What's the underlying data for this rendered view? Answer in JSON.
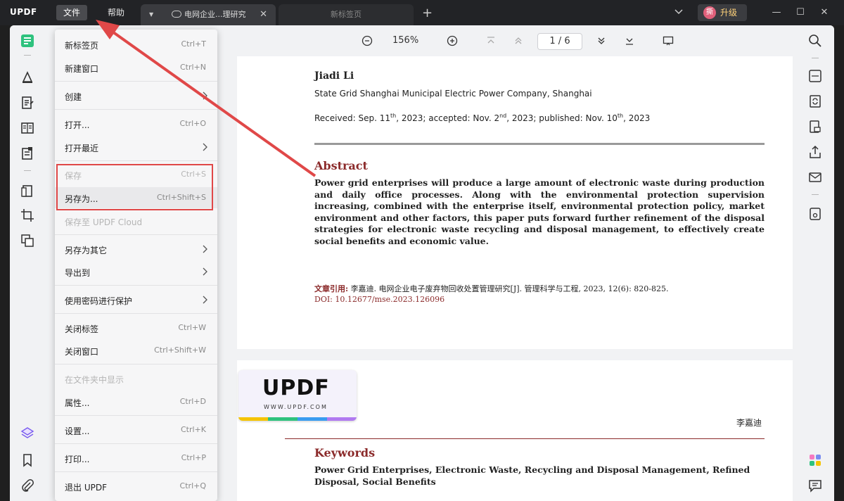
{
  "app": {
    "logo": "UPDF",
    "menus": [
      "文件",
      "帮助"
    ],
    "tabs": [
      {
        "label": "电网企业...理研究",
        "active": true
      },
      {
        "label": "新标签页",
        "active": false
      }
    ],
    "upgrade": {
      "avatar": "撕",
      "label": "升级"
    }
  },
  "toolbar": {
    "zoom": "156%",
    "page_current": "1",
    "page_sep": "/",
    "page_total": "6"
  },
  "file_menu": {
    "items": [
      {
        "label": "新标签页",
        "shortcut": "Ctrl+T"
      },
      {
        "label": "新建窗口",
        "shortcut": "Ctrl+N"
      },
      {
        "label": "创建",
        "submenu": true
      },
      {
        "label": "打开...",
        "shortcut": "Ctrl+O"
      },
      {
        "label": "打开最近",
        "submenu": true
      },
      {
        "label": "保存",
        "shortcut": "Ctrl+S",
        "disabled": true
      },
      {
        "label": "另存为...",
        "shortcut": "Ctrl+Shift+S"
      },
      {
        "label": "保存至 UPDF Cloud",
        "disabled": true
      },
      {
        "label": "另存为其它",
        "submenu": true
      },
      {
        "label": "导出到",
        "submenu": true
      },
      {
        "label": "使用密码进行保护",
        "submenu": true
      },
      {
        "label": "关闭标签",
        "shortcut": "Ctrl+W"
      },
      {
        "label": "关闭窗口",
        "shortcut": "Ctrl+Shift+W"
      },
      {
        "label": "在文件夹中显示",
        "disabled": true
      },
      {
        "label": "属性...",
        "shortcut": "Ctrl+D"
      },
      {
        "label": "设置...",
        "shortcut": "Ctrl+K"
      },
      {
        "label": "打印...",
        "shortcut": "Ctrl+P"
      },
      {
        "label": "退出 UPDF",
        "shortcut": "Ctrl+Q"
      }
    ]
  },
  "document": {
    "author": "Jiadi Li",
    "affiliation": "State Grid Shanghai Municipal Electric Power Company, Shanghai",
    "dates": {
      "received_prefix": "Received: Sep. 11",
      "received_sup": "th",
      "accepted_prefix": ", 2023; accepted: Nov. 2",
      "accepted_sup": "nd",
      "published_prefix": ", 2023; published: Nov. 10",
      "published_sup": "th",
      "tail": ", 2023"
    },
    "abstract_title": "Abstract",
    "abstract_text": "Power grid enterprises will produce a large amount of electronic waste during production and daily office processes. Along with the environmental protection supervision increasing, combined with the enterprise itself, environmental protection policy, market environment and other factors, this paper puts forward further refinement of the disposal strategies for electronic waste recycling and disposal management, to effectively create social benefits and economic value.",
    "citation_label": "文章引用:",
    "citation_text": "李嘉迪. 电网企业电子废弃物回收处置管理研究[J]. 管理科学与工程, 2023, 12(6): 820-825.",
    "doi": "DOI: 10.12677/mse.2023.126096",
    "watermark": {
      "big": "UPDF",
      "url": "WWW.UPDF.COM"
    },
    "author_cn": "李嘉迪",
    "keywords_title": "Keywords",
    "keywords_text": "Power Grid Enterprises, Electronic Waste, Recycling and Disposal Management, Refined Disposal, Social Benefits"
  },
  "colors": {
    "accent_red": "#e04848",
    "heading_red": "#8b2a2a",
    "brand_green": "#2ec27e"
  }
}
